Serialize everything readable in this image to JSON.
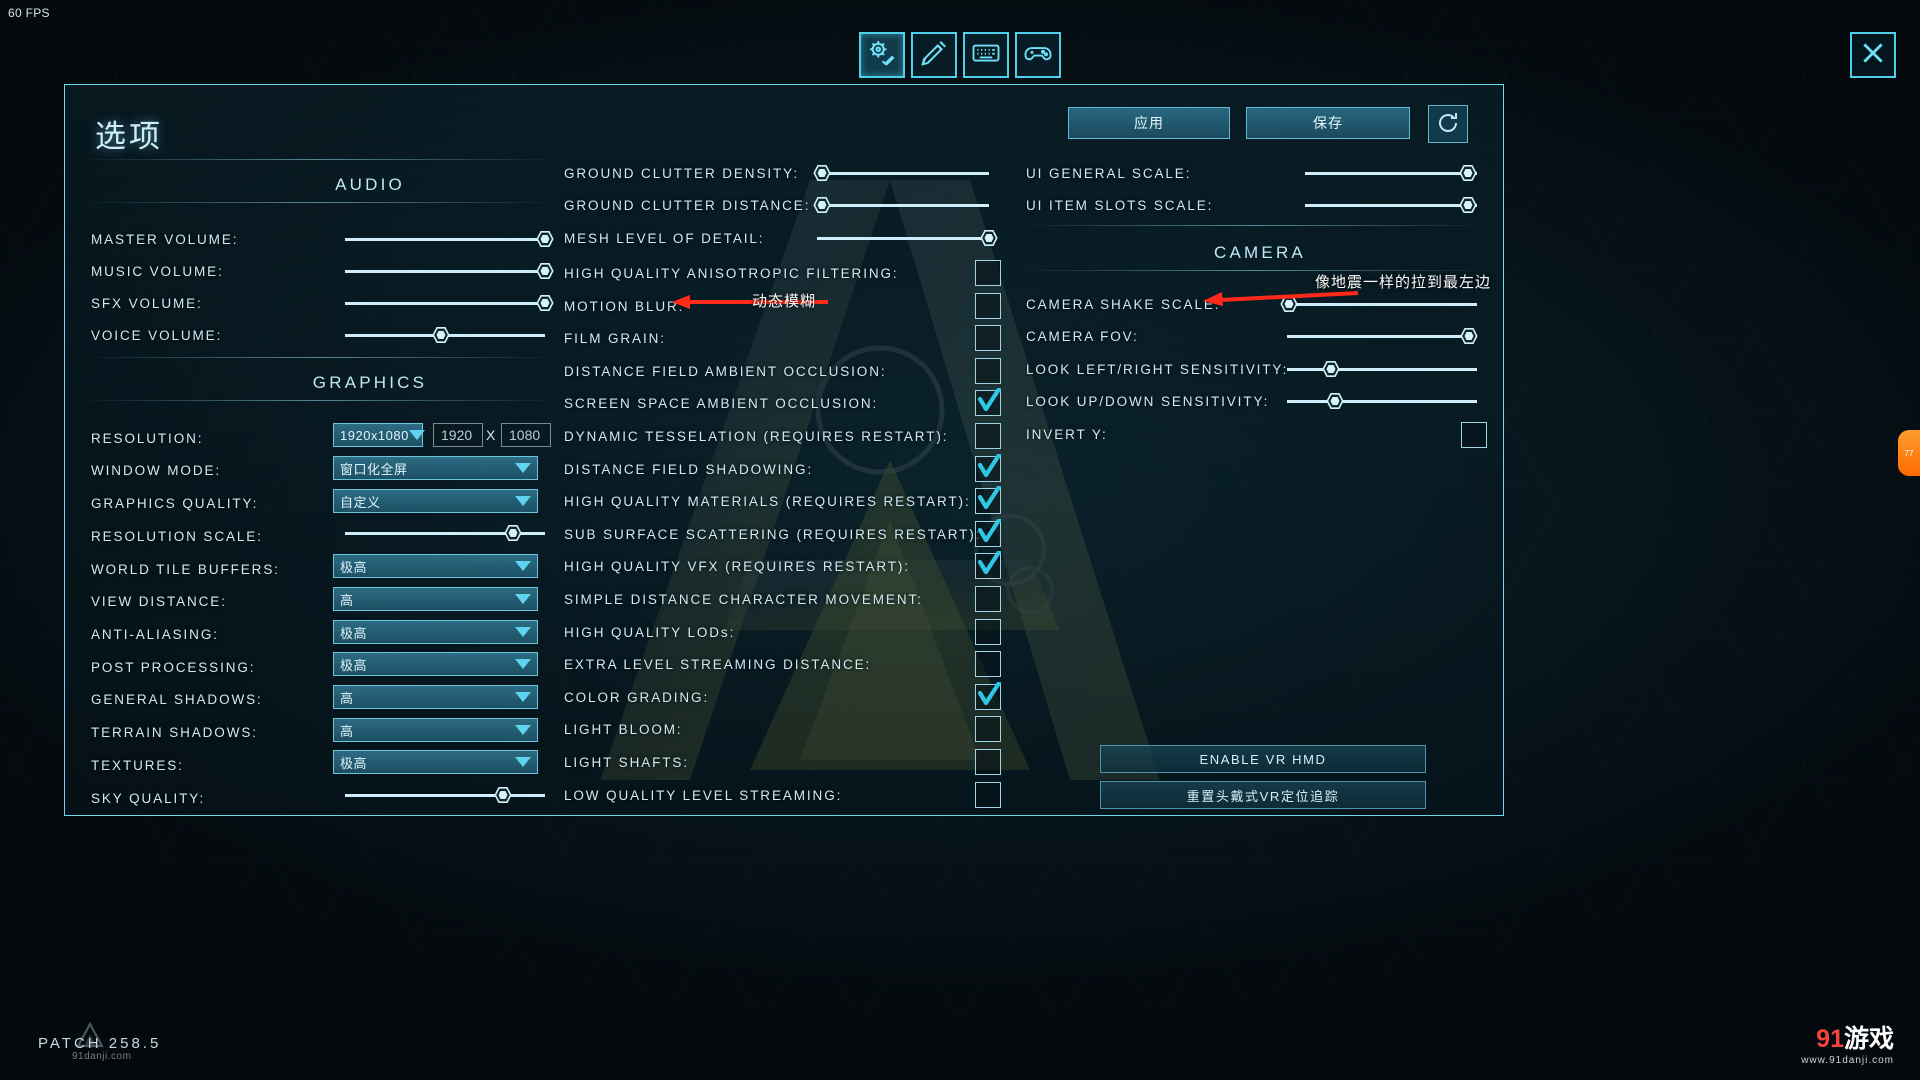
{
  "hud": {
    "fps": "60 FPS"
  },
  "tabs": [
    {
      "name": "options-tab",
      "icon": "gear-wrench-icon",
      "active": true
    },
    {
      "name": "controls-tab",
      "icon": "brush-tool-icon",
      "active": false
    },
    {
      "name": "keyboard-tab",
      "icon": "keyboard-icon",
      "active": false
    },
    {
      "name": "gamepad-tab",
      "icon": "gamepad-icon",
      "active": false
    }
  ],
  "close_icon": "close-icon",
  "panel": {
    "title": "选项",
    "apply_label": "应用",
    "save_label": "保存",
    "reset_icon": "reset-arrow-icon"
  },
  "sections": {
    "audio": "AUDIO",
    "graphics": "GRAPHICS",
    "camera": "CAMERA"
  },
  "audio": [
    {
      "label": "MASTER  VOLUME:",
      "value": 100
    },
    {
      "label": "MUSIC  VOLUME:",
      "value": 100
    },
    {
      "label": "SFX  VOLUME:",
      "value": 100
    },
    {
      "label": "VOICE  VOLUME:",
      "value": 48
    }
  ],
  "graphics": {
    "resolution": {
      "label": "RESOLUTION:",
      "value": "1920x1080",
      "width_value": "1920",
      "height_value": "1080",
      "separator": "X"
    },
    "window_mode": {
      "label": "WINDOW  MODE:",
      "value": "窗口化全屏"
    },
    "graphics_quality": {
      "label": "GRAPHICS  QUALITY:",
      "value": "自定义"
    },
    "resolution_scale": {
      "label": "RESOLUTION  SCALE:",
      "value": 84
    },
    "world_tile_buffers": {
      "label": "WORLD  TILE  BUFFERS:",
      "value": "极高"
    },
    "view_distance": {
      "label": "VIEW  DISTANCE:",
      "value": "高"
    },
    "anti_aliasing": {
      "label": "ANTI-ALIASING:",
      "value": "极高"
    },
    "post_processing": {
      "label": "POST  PROCESSING:",
      "value": "极高"
    },
    "general_shadows": {
      "label": "GENERAL  SHADOWS:",
      "value": "高"
    },
    "terrain_shadows": {
      "label": "TERRAIN  SHADOWS:",
      "value": "高"
    },
    "textures": {
      "label": "TEXTURES:",
      "value": "极高"
    },
    "sky_quality": {
      "label": "SKY  QUALITY:",
      "value": 79
    }
  },
  "center": {
    "sliders": [
      {
        "label": "GROUND  CLUTTER  DENSITY:",
        "value": 4
      },
      {
        "label": "GROUND  CLUTTER  DISTANCE:",
        "value": 4
      },
      {
        "label": "MESH  LEVEL  OF  DETAIL:",
        "value": 100
      }
    ],
    "checks": [
      {
        "label": "HIGH  QUALITY  ANISOTROPIC  FILTERING:",
        "checked": false
      },
      {
        "label": "MOTION  BLUR:",
        "checked": false
      },
      {
        "label": "FILM  GRAIN:",
        "checked": false
      },
      {
        "label": "DISTANCE  FIELD  AMBIENT  OCCLUSION:",
        "checked": false
      },
      {
        "label": "SCREEN  SPACE  AMBIENT  OCCLUSION:",
        "checked": true
      },
      {
        "label": "DYNAMIC  TESSELATION  (REQUIRES  RESTART):",
        "checked": false
      },
      {
        "label": "DISTANCE  FIELD  SHADOWING:",
        "checked": true
      },
      {
        "label": "HIGH  QUALITY  MATERIALS  (REQUIRES  RESTART):",
        "checked": true
      },
      {
        "label": "SUB  SURFACE  SCATTERING  (REQUIRES  RESTART):",
        "checked": true
      },
      {
        "label": "HIGH  QUALITY  VFX  (REQUIRES  RESTART):",
        "checked": true
      },
      {
        "label": "SIMPLE  DISTANCE  CHARACTER  MOVEMENT:",
        "checked": false
      },
      {
        "label": "HIGH  QUALITY  LODs:",
        "checked": false
      },
      {
        "label": "EXTRA  LEVEL  STREAMING  DISTANCE:",
        "checked": false
      },
      {
        "label": "COLOR  GRADING:",
        "checked": true
      },
      {
        "label": "LIGHT  BLOOM:",
        "checked": false
      },
      {
        "label": "LIGHT  SHAFTS:",
        "checked": false
      },
      {
        "label": "LOW  QUALITY  LEVEL  STREAMING:",
        "checked": false
      }
    ]
  },
  "right": {
    "ui_sliders": [
      {
        "label": "UI  GENERAL  SCALE:",
        "value": 95
      },
      {
        "label": "UI  ITEM  SLOTS  SCALE:",
        "value": 95
      }
    ],
    "camera_sliders": [
      {
        "label": "CAMERA  SHAKE  SCALE:",
        "value": 1
      },
      {
        "label": "CAMERA  FOV:",
        "value": 96
      },
      {
        "label": "LOOK  LEFT/RIGHT  SENSITIVITY:",
        "value": 23
      },
      {
        "label": "LOOK  UP/DOWN  SENSITIVITY:",
        "value": 25
      }
    ],
    "invert_y": {
      "label": "INVERT  Y:",
      "checked": false
    },
    "vr_enable_label": "ENABLE  VR  HMD",
    "vr_reset_label": "重置头戴式VR定位追踪"
  },
  "annotations": [
    {
      "text": "动态模糊",
      "target": "motion-blur"
    },
    {
      "text": "像地震一样的拉到最左边",
      "target": "camera-shake-scale"
    }
  ],
  "footer": {
    "patch": "PATCH  258.5",
    "watermark_main": "91",
    "watermark_rest": "游戏",
    "watermark_sub": "www.91danji.com",
    "watermark_left": "91danji.com"
  },
  "colors": {
    "accent": "#5fd4f0",
    "panel_border": "#6fd8ef",
    "text": "#cfeaf4",
    "annotation": "#ff2a1a",
    "check": "#2ec8e6"
  }
}
